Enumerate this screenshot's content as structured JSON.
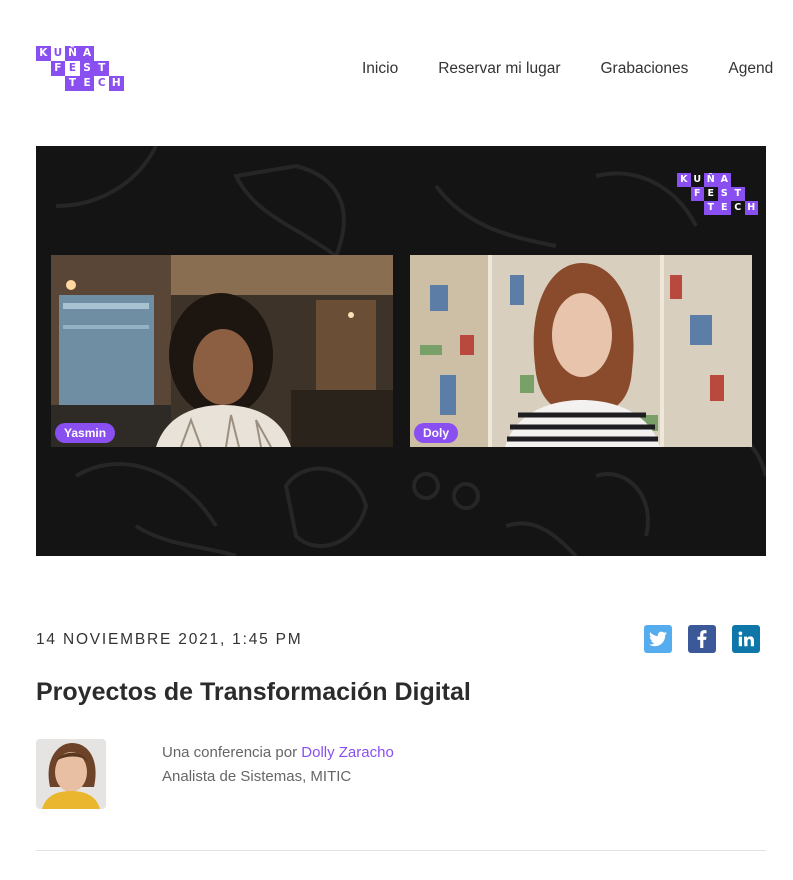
{
  "brand": {
    "logo_rows": [
      [
        "KU",
        "Ñ",
        "A"
      ],
      [
        "FE",
        "S",
        "T"
      ],
      [
        "TE",
        "C",
        "H"
      ]
    ],
    "accent_color": "#8a4ff0"
  },
  "nav": {
    "items": [
      "Inicio",
      "Reservar mi lugar",
      "Grabaciones",
      "Agend"
    ]
  },
  "video": {
    "participants": [
      {
        "name": "Yasmin"
      },
      {
        "name": "Doly"
      }
    ]
  },
  "event": {
    "date": "14 NOVIEMBRE 2021, 1:45 PM",
    "title": "Proyectos de Transformación Digital",
    "byline_prefix": "Una conferencia por",
    "speaker_name": "Dolly Zaracho",
    "speaker_role": "Analista de Sistemas, MITIC"
  },
  "share": {
    "icons": [
      "twitter-icon",
      "facebook-icon",
      "linkedin-icon"
    ],
    "colors": {
      "twitter": "#55acee",
      "facebook": "#3b5998",
      "linkedin": "#0e76a8"
    }
  }
}
